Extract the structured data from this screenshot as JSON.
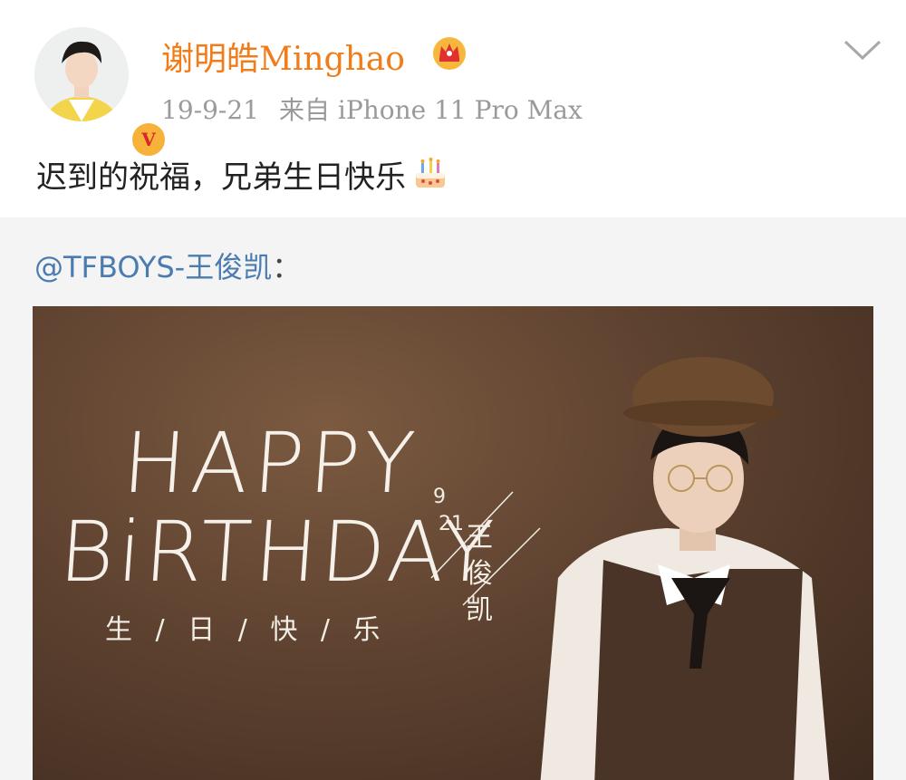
{
  "post": {
    "username": "谢明皓Minghao",
    "date": "19-9-21",
    "source": "来自 iPhone 11 Pro Max",
    "verified_badge": "V",
    "text": "迟到的祝福，兄弟生日快乐",
    "icons": [
      "crown-icon",
      "chevron-down-icon",
      "cake-icon",
      "verified-badge"
    ]
  },
  "repost": {
    "author": "@TFBOYS-王俊凯",
    "colon": "："
  },
  "banner": {
    "line1": "HAPPY",
    "line2": "BiRTHDAY",
    "subtitle": "生 / 日 / 快 / 乐",
    "date_month": "9",
    "date_day": "21",
    "name": "王俊凯"
  },
  "colors": {
    "username": "#f07d1a",
    "link": "#4a7bb1",
    "meta": "#9a9a9a",
    "repost_bg": "#f4f4f4"
  }
}
